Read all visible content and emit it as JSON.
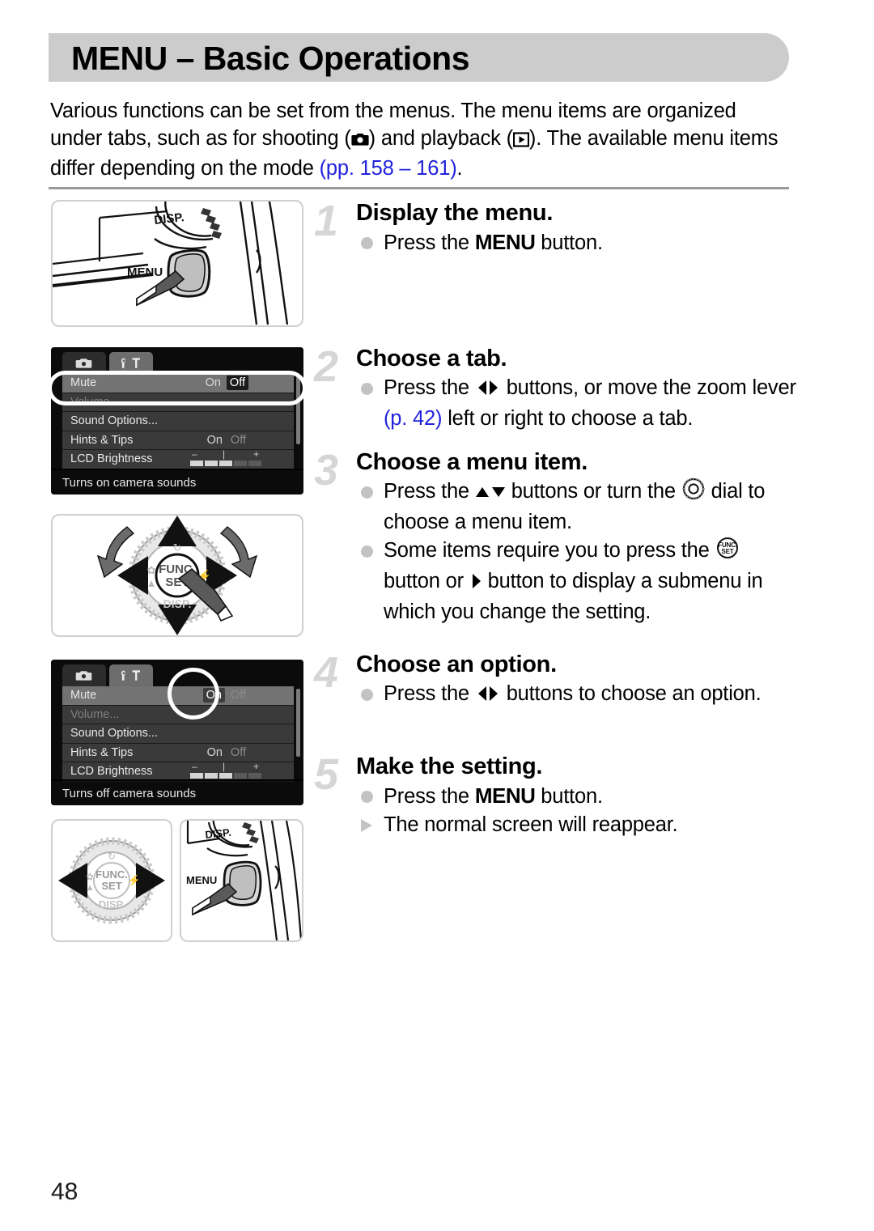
{
  "page": {
    "title": "MENU – Basic Operations",
    "number": "48"
  },
  "intro": {
    "line1_a": "Various functions can be set from the menus. The menu items are organized",
    "line2_a": "under tabs, such as for shooting (",
    "line2_b": ") and playback (",
    "line2_c": "). The available",
    "line3_a": "menu items differ depending on the mode ",
    "link_pages": "(pp. 158 – 161)",
    "line3_end": ".",
    "shooting_icon": "camera-icon",
    "playback_icon": "playback-icon"
  },
  "steps": [
    {
      "num": "1",
      "heading": "Display the menu.",
      "bullets": [
        {
          "marker": "dot",
          "pre": "Press the ",
          "menu_word": "MENU",
          "post": " button."
        }
      ]
    },
    {
      "num": "2",
      "heading": "Choose a tab.",
      "bullets": [
        {
          "marker": "dot",
          "pre": "Press the ",
          "icon": "left-right-arrows-icon",
          "post": " buttons, or move the zoom lever ",
          "link": "(p. 42)",
          "post2": " left or right to choose a tab."
        }
      ]
    },
    {
      "num": "3",
      "heading": "Choose a menu item.",
      "bullets": [
        {
          "marker": "dot",
          "pre": "Press the ",
          "icon": "up-down-arrows-icon",
          "mid": " buttons or turn the ",
          "icon2": "control-dial-icon",
          "post": " dial to choose a menu item."
        },
        {
          "marker": "dot",
          "pre": "Some items require you to press the ",
          "icon": "func-set-icon",
          "mid": " button or ",
          "icon2": "right-arrow-icon",
          "post": " button to display a submenu in which you change the setting."
        }
      ]
    },
    {
      "num": "4",
      "heading": "Choose an option.",
      "bullets": [
        {
          "marker": "dot",
          "pre": "Press the ",
          "icon": "left-right-arrows-icon",
          "post": " buttons to choose an option."
        }
      ]
    },
    {
      "num": "5",
      "heading": "Make the setting.",
      "bullets": [
        {
          "marker": "dot",
          "pre": "Press the ",
          "menu_word": "MENU",
          "post": " button."
        },
        {
          "marker": "triangle",
          "pre": "The normal screen will reappear."
        }
      ]
    }
  ],
  "figures": {
    "camera_1": {
      "name": "camera-back-menu-button",
      "labels": {
        "menu": "MENU",
        "disp": "DISP."
      }
    },
    "dial": {
      "name": "control-dial-func-set",
      "labels": {
        "func": "FUNC.",
        "set": "SET",
        "disp": "DISP."
      }
    },
    "dial_lr": {
      "name": "control-dial-left-right",
      "labels": {
        "func": "FUNC.",
        "set": "SET",
        "disp": "DISP."
      }
    },
    "camera_2": {
      "name": "camera-back-menu-button",
      "labels": {
        "menu": "MENU",
        "disp": "DISP."
      }
    }
  },
  "lcd_screens": [
    {
      "name": "menu-screen-mute-off",
      "tabs": [
        {
          "icon": "camera-tab-icon",
          "selected": false
        },
        {
          "icon": "settings-tab-icon",
          "selected": true
        }
      ],
      "rows": [
        {
          "label": "Mute",
          "highlighted": true,
          "values": [
            {
              "text": "On",
              "state": "plain"
            },
            {
              "text": "Off",
              "state": "boxed"
            }
          ]
        },
        {
          "label": "Volume...",
          "dim": true,
          "values": []
        },
        {
          "label": "Sound Options...",
          "values": []
        },
        {
          "label": "Hints & Tips",
          "values": [
            {
              "text": "On",
              "state": "plain"
            },
            {
              "text": "Off",
              "state": "dim"
            }
          ]
        },
        {
          "label": "LCD Brightness",
          "slider": {
            "minus": "–",
            "plus": "+",
            "tick": "|",
            "segments": [
              1,
              1,
              1,
              0,
              0
            ]
          }
        }
      ],
      "hint": "Turns on camera sounds"
    },
    {
      "name": "menu-screen-mute-on",
      "tabs": [
        {
          "icon": "camera-tab-icon",
          "selected": false
        },
        {
          "icon": "settings-tab-icon",
          "selected": true
        }
      ],
      "rows": [
        {
          "label": "Mute",
          "highlighted": true,
          "values": [
            {
              "text": "On",
              "state": "boxed-light"
            },
            {
              "text": "Off",
              "state": "dim"
            }
          ]
        },
        {
          "label": "Volume...",
          "dim": true,
          "values": []
        },
        {
          "label": "Sound Options...",
          "values": []
        },
        {
          "label": "Hints & Tips",
          "values": [
            {
              "text": "On",
              "state": "plain"
            },
            {
              "text": "Off",
              "state": "dim"
            }
          ]
        },
        {
          "label": "LCD Brightness",
          "slider": {
            "minus": "–",
            "plus": "+",
            "tick": "|",
            "segments": [
              1,
              1,
              1,
              0,
              0
            ]
          }
        }
      ],
      "hint": "Turns off camera sounds"
    }
  ],
  "colors": {
    "header_bg": "#cccccc",
    "link": "#2222dd",
    "step_number": "#d6d6d6",
    "bullet": "#c3c3c3",
    "rule": "#9a9a9a"
  }
}
